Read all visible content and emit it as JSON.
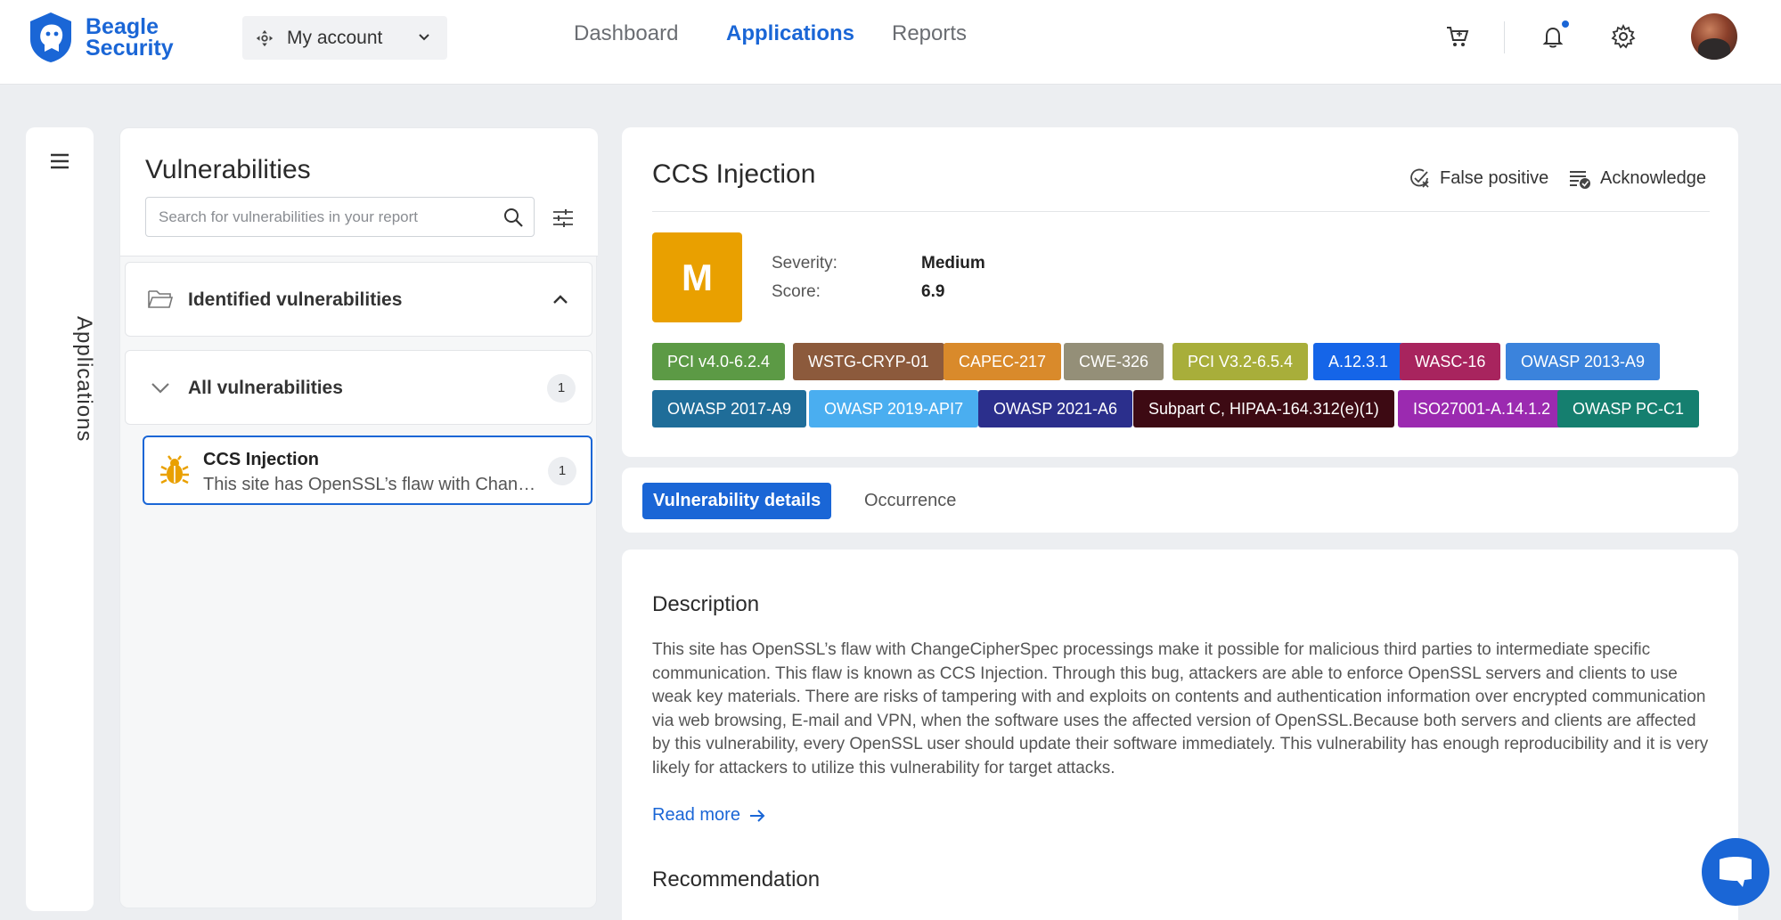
{
  "brand": {
    "name_line1": "Beagle",
    "name_line2": "Security",
    "color": "#1a66d6"
  },
  "account": {
    "label": "My account"
  },
  "nav": [
    {
      "label": "Dashboard",
      "active": false
    },
    {
      "label": "Applications",
      "active": true
    },
    {
      "label": "Reports",
      "active": false
    }
  ],
  "top_icons": [
    "cart-icon",
    "bell-icon",
    "gear-icon",
    "user-avatar"
  ],
  "rail": {
    "label": "Applications"
  },
  "left_panel": {
    "title": "Vulnerabilities",
    "search_placeholder": "Search for vulnerabilities in your report",
    "identified_label": "Identified vulnerabilities",
    "all_label": "All vulnerabilities",
    "all_count": "1",
    "items": [
      {
        "title": "CCS Injection",
        "summary": "This site has OpenSSL’s flaw with ChangeCipherSpec processings",
        "count": "1"
      }
    ]
  },
  "detail": {
    "title": "CCS Injection",
    "false_positive_label": "False positive",
    "acknowledge_label": "Acknowledge",
    "severity_letter": "M",
    "severity_color": "#e9a000",
    "severity_label": "Severity:",
    "severity_value": "Medium",
    "score_label": "Score:",
    "score_value": "6.9",
    "tags": [
      {
        "label": "PCI v4.0-6.2.4",
        "color": "#5c9a45"
      },
      {
        "label": "WSTG-CRYP-01",
        "color": "#8c5a3c"
      },
      {
        "label": "CAPEC-217",
        "color": "#d98a2b"
      },
      {
        "label": "CWE-326",
        "color": "#948f78"
      },
      {
        "label": "PCI V3.2-6.5.4",
        "color": "#a8ae3a"
      },
      {
        "label": "A.12.3.1",
        "color": "#1565e8"
      },
      {
        "label": "WASC-16",
        "color": "#a8245e"
      },
      {
        "label": "OWASP 2013-A9",
        "color": "#3b83dc"
      },
      {
        "label": "OWASP 2017-A9",
        "color": "#1f6d99"
      },
      {
        "label": "OWASP 2019-API7",
        "color": "#4aaef0"
      },
      {
        "label": "OWASP 2021-A6",
        "color": "#2b2f8c"
      },
      {
        "label": "Subpart C, HIPAA-164.312(e)(1)",
        "color": "#3d0a13"
      },
      {
        "label": "ISO27001-A.14.1.2",
        "color": "#9b2ab0"
      },
      {
        "label": "OWASP PC-C1",
        "color": "#157f6f"
      }
    ]
  },
  "tabs": {
    "active": "Vulnerability details",
    "inactive": "Occurrence"
  },
  "description": {
    "heading": "Description",
    "text": "This site has OpenSSL’s flaw with ChangeCipherSpec processings make it possible for malicious third parties to intermediate specific communication. This flaw is known as CCS Injection. Through this bug, attackers are able to enforce OpenSSL servers and clients to use weak key materials. There are risks of tampering with and exploits on contents and authentication information over encrypted communication via web browsing, E-mail and VPN, when the software uses the affected version of OpenSSL.Because both servers and clients are affected by this vulnerability, every OpenSSL user should update their software immediately. This vulnerability has enough reproducibility and it is very likely for attackers to utilize this vulnerability for target attacks.",
    "read_more": "Read more",
    "next_heading": "Recommendation"
  }
}
